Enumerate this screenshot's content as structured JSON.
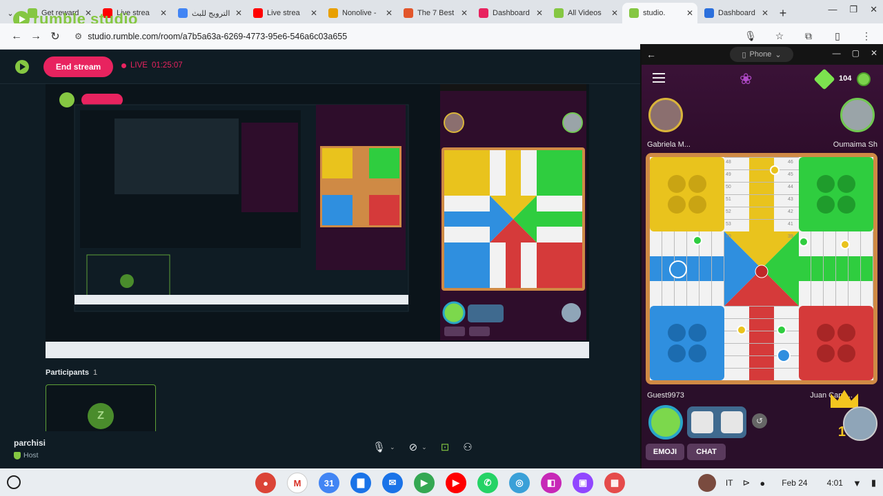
{
  "browser": {
    "tabs": [
      {
        "label": "Get reward",
        "fav_color": "#85c742"
      },
      {
        "label": "Live strea",
        "fav_color": "#ff0000"
      },
      {
        "label": "الترويج للبث",
        "fav_color": "#4285f4"
      },
      {
        "label": "Live strea",
        "fav_color": "#ff0000"
      },
      {
        "label": "Nonolive - ",
        "fav_color": "#e8a000"
      },
      {
        "label": "The 7 Best",
        "fav_color": "#e2562b"
      },
      {
        "label": "Dashboard",
        "fav_color": "#e8235f"
      },
      {
        "label": "All Videos",
        "fav_color": "#85c742"
      },
      {
        "label": "studio.",
        "fav_color": "#85c742",
        "active": true
      },
      {
        "label": "Dashboard",
        "fav_color": "#2b6fdc"
      }
    ],
    "url": "studio.rumble.com/room/a7b5a63a-6269-4773-95e6-546a6c03a655",
    "logo_text": "rumble studio"
  },
  "studio": {
    "end_stream_label": "End stream",
    "live_label": "LIVE",
    "live_time": "01:25:07",
    "participants_label": "Participants",
    "participants_count": "1",
    "participant_initial": "Z",
    "host_name": "parchisi",
    "host_role": "Host",
    "colors": {
      "accent": "#85c742",
      "danger": "#e8235f",
      "bg": "#0f1c24"
    }
  },
  "phone": {
    "title": "Phone",
    "gem_count": "104",
    "player1": "Gabriela M...",
    "player2": "Oumaima Sh",
    "player3": "Guest9973",
    "player4": "Juan Capit...",
    "juan_rank": "1",
    "emoji_label": "EMOJI",
    "chat_label": "CHAT",
    "board_numbers": [
      "48",
      "49",
      "50",
      "51",
      "52",
      "53",
      "46",
      "45",
      "44",
      "43",
      "42",
      "41",
      "40",
      "39"
    ]
  },
  "taskbar": {
    "apps": [
      {
        "name": "chrome",
        "color": "#db4437",
        "glyph": "●"
      },
      {
        "name": "gmail",
        "color": "#ffffff",
        "glyph": "M"
      },
      {
        "name": "calendar",
        "color": "#4285f4",
        "glyph": "31"
      },
      {
        "name": "files",
        "color": "#1a73e8",
        "glyph": "▇"
      },
      {
        "name": "messages",
        "color": "#1a73e8",
        "glyph": "✉"
      },
      {
        "name": "meet",
        "color": "#34a853",
        "glyph": "▶"
      },
      {
        "name": "youtube",
        "color": "#ff0000",
        "glyph": "▶"
      },
      {
        "name": "whatsapp",
        "color": "#25d366",
        "glyph": "✆"
      },
      {
        "name": "app-blue",
        "color": "#3aa0d8",
        "glyph": "◎"
      },
      {
        "name": "app-pink",
        "color": "#c728b7",
        "glyph": "◧"
      },
      {
        "name": "twitch",
        "color": "#9146ff",
        "glyph": "▣"
      },
      {
        "name": "app-multi",
        "color": "#e54b4b",
        "glyph": "▦"
      }
    ],
    "lang": "IT",
    "date": "Feb 24",
    "time": "4:01"
  }
}
